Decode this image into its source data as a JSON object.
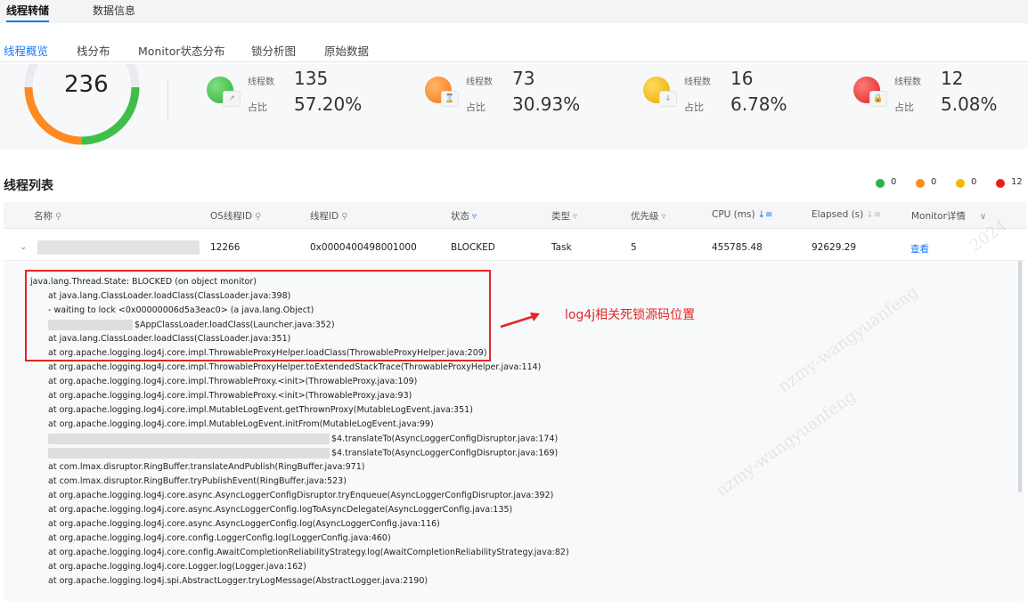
{
  "top_tabs": [
    {
      "label": "线程转储",
      "active": true
    },
    {
      "label": "数据信息",
      "active": false
    }
  ],
  "sub_tabs": [
    {
      "label": "线程概览",
      "active": true
    },
    {
      "label": "栈分布",
      "active": false
    },
    {
      "label": "Monitor状态分布",
      "active": false
    },
    {
      "label": "锁分析图",
      "active": false
    },
    {
      "label": "原始数据",
      "active": false
    }
  ],
  "summary": {
    "total": "236",
    "stats": [
      {
        "count_label": "线程数",
        "count": "135",
        "ratio_label": "占比",
        "ratio": "57.20%",
        "color": "#3fbf4a",
        "icon": "running-icon"
      },
      {
        "count_label": "线程数",
        "count": "73",
        "ratio_label": "占比",
        "ratio": "30.93%",
        "color": "#ff8a1f",
        "icon": "waiting-icon"
      },
      {
        "count_label": "线程数",
        "count": "16",
        "ratio_label": "占比",
        "ratio": "6.78%",
        "color": "#f5b800",
        "icon": "timed-waiting-icon"
      },
      {
        "count_label": "线程数",
        "count": "12",
        "ratio_label": "占比",
        "ratio": "5.08%",
        "color": "#ee2e2e",
        "icon": "blocked-icon"
      }
    ]
  },
  "thread_list": {
    "title": "线程列表",
    "legend": [
      {
        "color": "#2fb344",
        "count": "0"
      },
      {
        "color": "#ff8a1f",
        "count": "0"
      },
      {
        "color": "#f5b800",
        "count": "0"
      },
      {
        "color": "#e62020",
        "count": "12"
      }
    ],
    "columns": [
      {
        "label": "名称",
        "icon": "search-icon"
      },
      {
        "label": "OS线程ID",
        "icon": "search-icon"
      },
      {
        "label": "线程ID",
        "icon": "search-icon"
      },
      {
        "label": "状态",
        "icon": "filter-icon"
      },
      {
        "label": "类型",
        "icon": "filter-icon"
      },
      {
        "label": "优先级",
        "icon": "filter-icon"
      },
      {
        "label": "CPU (ms)",
        "icon": "sort-icon"
      },
      {
        "label": "Elapsed (s)",
        "icon": "sort-icon"
      },
      {
        "label": "Monitor详情",
        "icon": "chevron-down-icon"
      }
    ],
    "row": {
      "os_thread_id": "12266",
      "thread_id": "0x0000400498001000",
      "state": "BLOCKED",
      "type": "Task",
      "priority": "5",
      "cpu": "455785.48",
      "elapsed": "92629.29",
      "monitor": "查看"
    }
  },
  "stack_trace": [
    "java.lang.Thread.State: BLOCKED (on object monitor)",
    "at java.lang.ClassLoader.loadClass(ClassLoader.java:398)",
    "- waiting to lock <0x00000006d5a3eac0> (a java.lang.Object)",
    "$AppClassLoader.loadClass(Launcher.java:352)",
    "at java.lang.ClassLoader.loadClass(ClassLoader.java:351)",
    "at org.apache.logging.log4j.core.impl.ThrowableProxyHelper.loadClass(ThrowableProxyHelper.java:209)",
    "at org.apache.logging.log4j.core.impl.ThrowableProxyHelper.toExtendedStackTrace(ThrowableProxyHelper.java:114)",
    "at org.apache.logging.log4j.core.impl.ThrowableProxy.<init>(ThrowableProxy.java:109)",
    "at org.apache.logging.log4j.core.impl.ThrowableProxy.<init>(ThrowableProxy.java:93)",
    "at org.apache.logging.log4j.core.impl.MutableLogEvent.getThrownProxy(MutableLogEvent.java:351)",
    "at org.apache.logging.log4j.core.impl.MutableLogEvent.initFrom(MutableLogEvent.java:99)",
    "$4.translateTo(AsyncLoggerConfigDisruptor.java:174)",
    "$4.translateTo(AsyncLoggerConfigDisruptor.java:169)",
    "at com.lmax.disruptor.RingBuffer.translateAndPublish(RingBuffer.java:971)",
    "at com.lmax.disruptor.RingBuffer.tryPublishEvent(RingBuffer.java:523)",
    "at org.apache.logging.log4j.core.async.AsyncLoggerConfigDisruptor.tryEnqueue(AsyncLoggerConfigDisruptor.java:392)",
    "at org.apache.logging.log4j.core.async.AsyncLoggerConfig.logToAsyncDelegate(AsyncLoggerConfig.java:135)",
    "at org.apache.logging.log4j.core.async.AsyncLoggerConfig.log(AsyncLoggerConfig.java:116)",
    "at org.apache.logging.log4j.core.config.LoggerConfig.log(LoggerConfig.java:460)",
    "at org.apache.logging.log4j.core.config.AwaitCompletionReliabilityStrategy.log(AwaitCompletionReliabilityStrategy.java:82)",
    "at org.apache.logging.log4j.core.Logger.log(Logger.java:162)",
    "at org.apache.logging.log4j.spi.AbstractLogger.tryLogMessage(AbstractLogger.java:2190)"
  ],
  "annotation": "log4j相关死锁源码位置",
  "watermark": "nzmy-wangyuanfeng",
  "watermark_year": "2024"
}
